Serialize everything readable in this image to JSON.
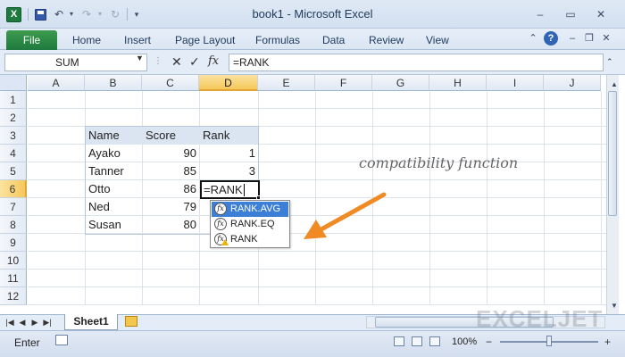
{
  "window": {
    "title": "book1 - Microsoft Excel"
  },
  "ribbon": {
    "file_label": "File",
    "tabs": [
      "Home",
      "Insert",
      "Page Layout",
      "Formulas",
      "Data",
      "Review",
      "View"
    ]
  },
  "formula_bar": {
    "name_box": "SUM",
    "formula": "=RANK"
  },
  "columns": [
    "A",
    "B",
    "C",
    "D",
    "E",
    "F",
    "G",
    "H",
    "I",
    "J"
  ],
  "rows": [
    "1",
    "2",
    "3",
    "4",
    "5",
    "6",
    "7",
    "8",
    "9",
    "10",
    "11",
    "12"
  ],
  "table": {
    "headers": [
      "Name",
      "Score",
      "Rank"
    ],
    "rows": [
      {
        "name": "Ayako",
        "score": "90",
        "rank": "1"
      },
      {
        "name": "Tanner",
        "score": "85",
        "rank": "3"
      },
      {
        "name": "Otto",
        "score": "86",
        "rank": "=RANK"
      },
      {
        "name": "Ned",
        "score": "79",
        "rank": ""
      },
      {
        "name": "Susan",
        "score": "80",
        "rank": ""
      }
    ]
  },
  "autocomplete": {
    "items": [
      "RANK.AVG",
      "RANK.EQ",
      "RANK"
    ],
    "selected": "RANK.AVG"
  },
  "annotation": "compatibility function",
  "sheet_tab": "Sheet1",
  "status_bar": {
    "mode": "Enter",
    "zoom": "100%"
  },
  "watermark": "EXCELJET",
  "colors": {
    "arrow": "#f08a24",
    "excel_green": "#1f7a3e",
    "selection": "#3b7fd6",
    "header_fill": "#dbe5f1"
  }
}
